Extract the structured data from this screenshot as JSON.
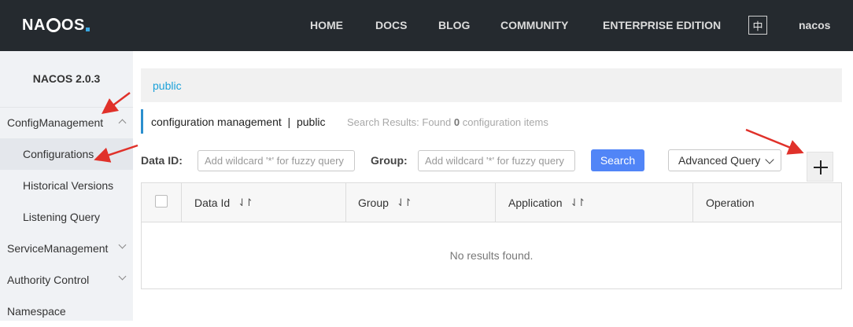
{
  "navbar": {
    "logo_text_left": "NA",
    "logo_text_right": "OS",
    "items": [
      "HOME",
      "DOCS",
      "BLOG",
      "COMMUNITY",
      "ENTERPRISE EDITION"
    ],
    "lang_toggle": "中",
    "user": "nacos"
  },
  "sidebar": {
    "version": "NACOS 2.0.3",
    "items": [
      {
        "label": "ConfigManagement",
        "chevron": "up"
      },
      {
        "label": "Configurations"
      },
      {
        "label": "Historical Versions"
      },
      {
        "label": "Listening Query"
      },
      {
        "label": "ServiceManagement",
        "chevron": "down"
      },
      {
        "label": "Authority Control",
        "chevron": "down"
      },
      {
        "label": "Namespace"
      }
    ]
  },
  "main": {
    "namespace_tab": "public",
    "title": "configuration management  |  public",
    "results_prefix": "Search Results: Found",
    "results_count": "0",
    "results_suffix": "configuration items",
    "dataid_label": "Data ID:",
    "dataid_placeholder": "Add wildcard '*' for fuzzy query",
    "group_label": "Group:",
    "group_placeholder": "Add wildcard '*' for fuzzy query",
    "search_button": "Search",
    "advanced_query": "Advanced Query",
    "table": {
      "columns": [
        "Data Id",
        "Group",
        "Application",
        "Operation"
      ],
      "sort_glyph": "⇃↾",
      "empty_text": "No results found."
    }
  },
  "colors": {
    "navbar_bg": "#252a2f",
    "accent_blue": "#5185f7",
    "link_blue": "#1ba1d9",
    "annotation_red": "#e0312a"
  }
}
